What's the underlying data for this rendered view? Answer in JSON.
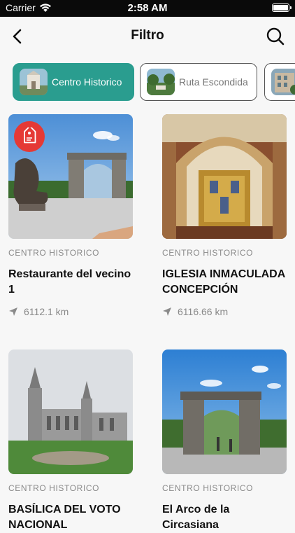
{
  "status": {
    "carrier": "Carrier",
    "time": "2:58 AM"
  },
  "nav": {
    "title": "Filtro"
  },
  "filters": [
    {
      "label": "Centro Historico",
      "active": true
    },
    {
      "label": "Ruta Escondida",
      "active": false
    },
    {
      "label": "",
      "active": false
    }
  ],
  "places": [
    {
      "category": "CENTRO HISTORICO",
      "title": "Restaurante del vecino 1",
      "distance": "6112.1 km",
      "has_promo": true
    },
    {
      "category": "CENTRO HISTORICO",
      "title": "IGLESIA INMACULADA CONCEPCIÓN",
      "distance": "6116.66 km",
      "has_promo": false
    },
    {
      "category": "CENTRO HISTORICO",
      "title": "BASÍLICA DEL VOTO NACIONAL",
      "distance": "",
      "has_promo": false
    },
    {
      "category": "CENTRO HISTORICO",
      "title": "El Arco de la Circasiana",
      "distance": "",
      "has_promo": false
    }
  ],
  "colors": {
    "accent": "#2a9d8f",
    "promo": "#e53935"
  }
}
